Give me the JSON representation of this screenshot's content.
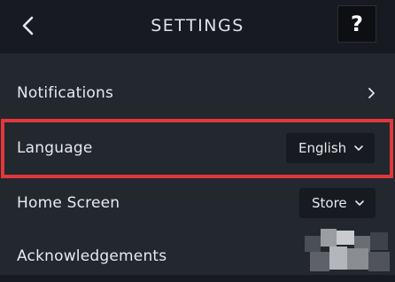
{
  "header": {
    "title": "SETTINGS",
    "back_icon": "chevron-left-icon",
    "help_label": "?"
  },
  "settings": {
    "notifications": {
      "label": "Notifications",
      "icon": "chevron-right-icon"
    },
    "language": {
      "label": "Language",
      "value": "English",
      "icon": "chevron-down-icon"
    },
    "home_screen": {
      "label": "Home Screen",
      "value": "Store",
      "icon": "chevron-down-icon"
    },
    "acknowledgements": {
      "label": "Acknowledgements"
    }
  },
  "colors": {
    "background": "#171a21",
    "panel": "#23272e",
    "highlight": "#e0383b",
    "text": "#e6e8ea"
  }
}
